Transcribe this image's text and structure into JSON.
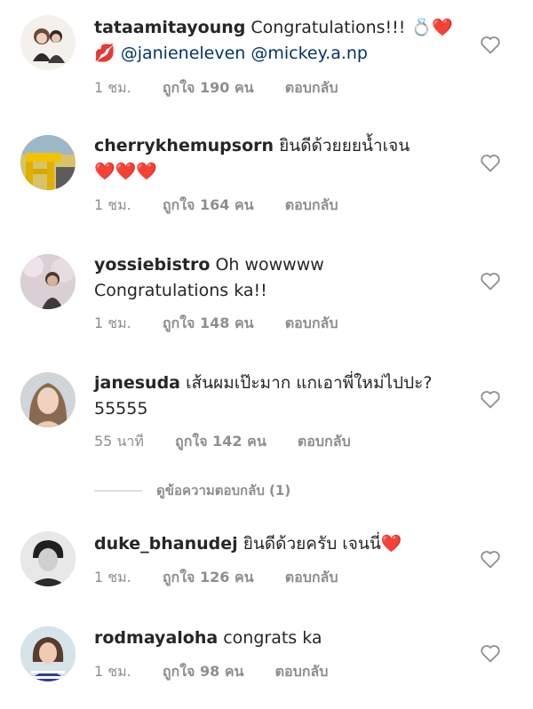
{
  "comments": [
    {
      "username": "tataamitayoung",
      "text": "Congratulations!!! 💍❤️",
      "line2_emoji": "💋",
      "mentions": "@janieneleven @mickey.a.np",
      "time": "1 ชม.",
      "likes": "ถูกใจ 190 คน",
      "reply": "ตอบกลับ"
    },
    {
      "username": "cherrykhemupsorn",
      "text": "ยินดีด้วยยยน้ำเจน",
      "line2": "❤️❤️❤️",
      "time": "1 ชม.",
      "likes": "ถูกใจ 164 คน",
      "reply": "ตอบกลับ"
    },
    {
      "username": "yossiebistro",
      "text": "Oh wowwww",
      "line2": "Congratulations ka!!",
      "time": "1 ชม.",
      "likes": "ถูกใจ 148 คน",
      "reply": "ตอบกลับ"
    },
    {
      "username": "janesuda",
      "text": "เส้นผมเป๊ะมาก แกเอาพี่ใหม่ไปปะ?",
      "line2": "55555",
      "time": "55 นาที",
      "likes": "ถูกใจ 142 คน",
      "reply": "ตอบกลับ"
    },
    {
      "username": "duke_bhanudej",
      "text": "ยินดีด้วยครับ เจนนี่❤️",
      "time": "1 ชม.",
      "likes": "ถูกใจ 126 คน",
      "reply": "ตอบกลับ"
    },
    {
      "username": "rodmayaloha",
      "text": "congrats ka",
      "time": "1 ชม.",
      "likes": "ถูกใจ 98 คน",
      "reply": "ตอบกลับ"
    }
  ],
  "view_replies": "ดูข้อความตอบกลับ (1)",
  "icons": {
    "like": "heart-outline-icon"
  },
  "colors": {
    "text": "#262626",
    "meta": "#8e8e8e",
    "mention": "#003569"
  }
}
